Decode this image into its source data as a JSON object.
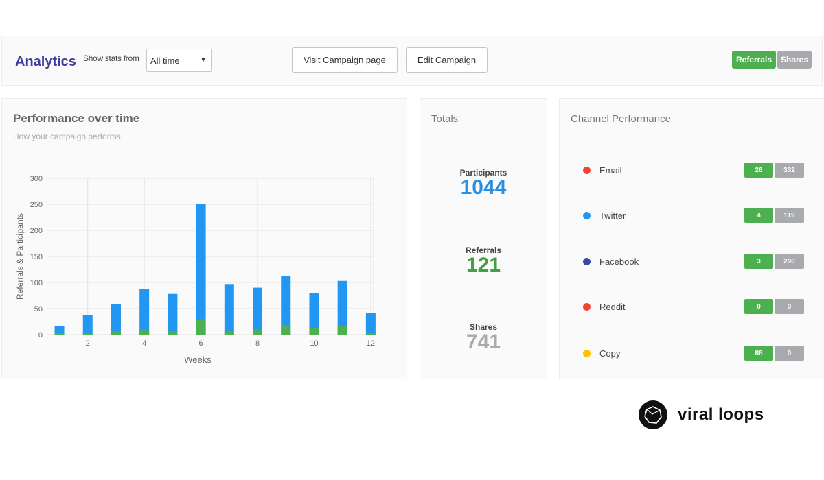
{
  "header": {
    "title": "Analytics",
    "stats_label": "Show stats from",
    "stats_select": {
      "selected": "All time"
    },
    "visit_button": "Visit Campaign page",
    "edit_button": "Edit Campaign",
    "toggle": {
      "referrals": "Referrals",
      "shares": "Shares",
      "active": "Referrals"
    }
  },
  "performance": {
    "title": "Performance over time",
    "subtitle": "How your campaign performs"
  },
  "chart_data": {
    "type": "bar",
    "stacked": true,
    "title": "Performance over time",
    "xlabel": "Weeks",
    "ylabel": "Referrals & Participants",
    "x": [
      1,
      2,
      3,
      4,
      5,
      6,
      7,
      8,
      9,
      10,
      11,
      12
    ],
    "x_tick_labels": [
      "2",
      "4",
      "6",
      "8",
      "10",
      "12"
    ],
    "x_ticks": [
      2,
      4,
      6,
      8,
      10,
      12
    ],
    "y_ticks": [
      0,
      50,
      100,
      150,
      200,
      250,
      300
    ],
    "ylim": [
      0,
      300
    ],
    "grid": true,
    "series": [
      {
        "name": "Referrals",
        "color": "#4caf50",
        "values": [
          3,
          4,
          6,
          9,
          7,
          30,
          8,
          10,
          18,
          13,
          17,
          4
        ]
      },
      {
        "name": "Participants",
        "color": "#2196f3",
        "values": [
          16,
          38,
          58,
          88,
          78,
          250,
          97,
          90,
          113,
          79,
          103,
          42
        ]
      }
    ]
  },
  "totals": {
    "title": "Totals",
    "items": [
      {
        "label": "Participants",
        "value": "1044",
        "color": "#2b8fe0"
      },
      {
        "label": "Referrals",
        "value": "121",
        "color": "#43a047"
      },
      {
        "label": "Shares",
        "value": "741",
        "color": "#a9aaad"
      }
    ]
  },
  "channels": {
    "title": "Channel Performance",
    "items": [
      {
        "name": "Email",
        "dot_color": "#f44336",
        "referrals": "26",
        "shares": "332"
      },
      {
        "name": "Twitter",
        "dot_color": "#2196f3",
        "referrals": "4",
        "shares": "119"
      },
      {
        "name": "Facebook",
        "dot_color": "#3949ab",
        "referrals": "3",
        "shares": "290"
      },
      {
        "name": "Reddit",
        "dot_color": "#f44336",
        "referrals": "0",
        "shares": "0"
      },
      {
        "name": "Copy",
        "dot_color": "#ffc107",
        "referrals": "88",
        "shares": "0"
      }
    ]
  },
  "brand": {
    "name": "viral loops"
  }
}
